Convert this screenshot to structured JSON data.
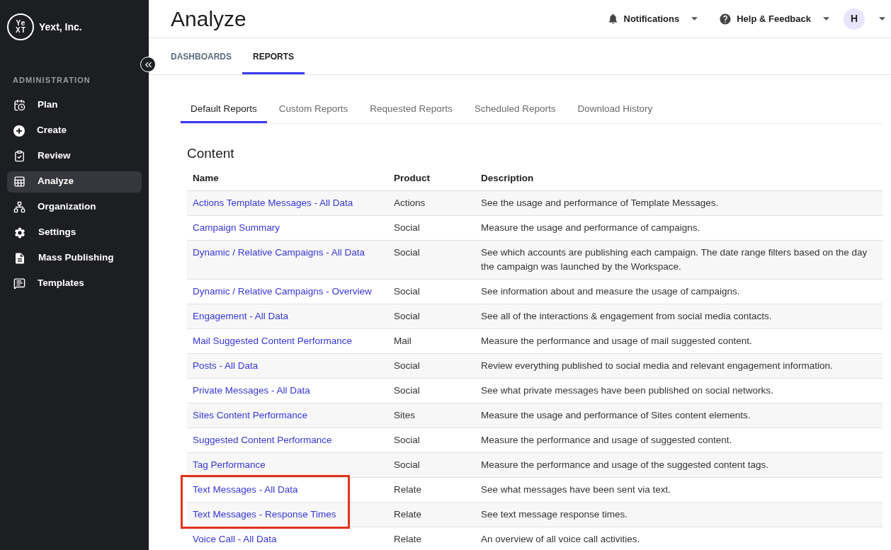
{
  "sidebar": {
    "logo_lines": [
      "Ye",
      "XT"
    ],
    "org_name": "Yext, Inc.",
    "section_label": "ADMINISTRATION",
    "items": [
      {
        "label": "Plan",
        "selected": false
      },
      {
        "label": "Create",
        "selected": false
      },
      {
        "label": "Review",
        "selected": false
      },
      {
        "label": "Analyze",
        "selected": true
      },
      {
        "label": "Organization",
        "selected": false
      },
      {
        "label": "Settings",
        "selected": false
      },
      {
        "label": "Mass Publishing",
        "selected": false
      },
      {
        "label": "Templates",
        "selected": false
      }
    ]
  },
  "header": {
    "title": "Analyze",
    "notifications": "Notifications",
    "help": "Help & Feedback",
    "avatar_initial": "H"
  },
  "nav_tabs": [
    {
      "label": "DASHBOARDS",
      "selected": false
    },
    {
      "label": "REPORTS",
      "selected": true
    }
  ],
  "report_tabs": [
    {
      "label": "Default Reports",
      "selected": true
    },
    {
      "label": "Custom Reports",
      "selected": false
    },
    {
      "label": "Requested Reports",
      "selected": false
    },
    {
      "label": "Scheduled Reports",
      "selected": false
    },
    {
      "label": "Download History",
      "selected": false
    }
  ],
  "section": {
    "title": "Content",
    "columns": [
      "Name",
      "Product",
      "Description"
    ],
    "rows": [
      {
        "name": "Actions Template Messages - All Data",
        "product": "Actions",
        "description": "See the usage and performance of Template Messages.",
        "highlighted": false
      },
      {
        "name": "Campaign Summary",
        "product": "Social",
        "description": "Measure the usage and performance of campaigns.",
        "highlighted": false
      },
      {
        "name": "Dynamic / Relative Campaigns - All Data",
        "product": "Social",
        "description": "See which accounts are publishing each campaign. The date range filters based on the day the campaign was launched by the Workspace.",
        "highlighted": false
      },
      {
        "name": "Dynamic / Relative Campaigns - Overview",
        "product": "Social",
        "description": "See information about and measure the usage of campaigns.",
        "highlighted": false
      },
      {
        "name": "Engagement - All Data",
        "product": "Social",
        "description": "See all of the interactions & engagement from social media contacts.",
        "highlighted": false
      },
      {
        "name": "Mail Suggested Content Performance",
        "product": "Mail",
        "description": "Measure the performance and usage of mail suggested content.",
        "highlighted": false
      },
      {
        "name": "Posts - All Data",
        "product": "Social",
        "description": "Review everything published to social media and relevant engagement information.",
        "highlighted": false
      },
      {
        "name": "Private Messages - All Data",
        "product": "Social",
        "description": "See what private messages have been published on social networks.",
        "highlighted": false
      },
      {
        "name": "Sites Content Performance",
        "product": "Sites",
        "description": "Measure the usage and performance of Sites content elements.",
        "highlighted": false
      },
      {
        "name": "Suggested Content Performance",
        "product": "Social",
        "description": "Measure the performance and usage of suggested content.",
        "highlighted": false
      },
      {
        "name": "Tag Performance",
        "product": "Social",
        "description": "Measure the performance and usage of the suggested content tags.",
        "highlighted": false
      },
      {
        "name": "Text Messages - All Data",
        "product": "Relate",
        "description": "See what messages have been sent via text.",
        "highlighted": true
      },
      {
        "name": "Text Messages - Response Times",
        "product": "Relate",
        "description": "See text message response times.",
        "highlighted": true
      },
      {
        "name": "Voice Call - All Data",
        "product": "Relate",
        "description": "An overview of all voice call activities.",
        "highlighted": false
      }
    ]
  }
}
